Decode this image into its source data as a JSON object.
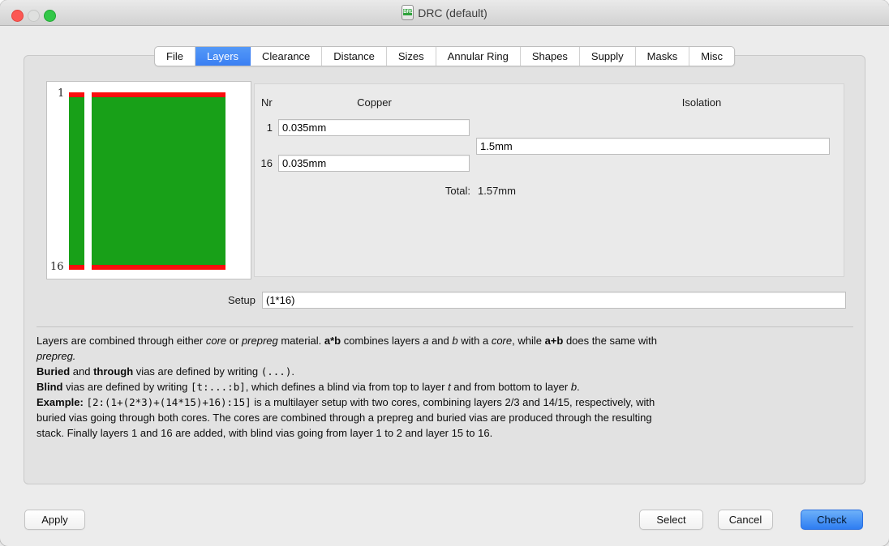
{
  "window": {
    "title": "DRC (default)",
    "icon_label": "BRD"
  },
  "tabs": [
    {
      "label": "File",
      "selected": false
    },
    {
      "label": "Layers",
      "selected": true
    },
    {
      "label": "Clearance",
      "selected": false
    },
    {
      "label": "Distance",
      "selected": false
    },
    {
      "label": "Sizes",
      "selected": false
    },
    {
      "label": "Annular Ring",
      "selected": false
    },
    {
      "label": "Shapes",
      "selected": false
    },
    {
      "label": "Supply",
      "selected": false
    },
    {
      "label": "Masks",
      "selected": false
    },
    {
      "label": "Misc",
      "selected": false
    }
  ],
  "preview": {
    "top_layer_label": "1",
    "bottom_layer_label": "16"
  },
  "stack_table": {
    "headers": {
      "nr": "Nr",
      "copper": "Copper",
      "isolation": "Isolation"
    },
    "rows": [
      {
        "nr": "1",
        "copper": "0.035mm"
      },
      {
        "nr": "16",
        "copper": "0.035mm"
      }
    ],
    "isolation_value": "1.5mm",
    "total_label": "Total:",
    "total_value": "1.57mm"
  },
  "setup": {
    "label": "Setup",
    "value": "(1*16)"
  },
  "description": {
    "lines": [
      [
        {
          "t": "Layers are combined through either "
        },
        {
          "t": "core",
          "s": "i"
        },
        {
          "t": " or "
        },
        {
          "t": "prepreg",
          "s": "i"
        },
        {
          "t": " material. "
        },
        {
          "t": "a*b",
          "s": "b"
        },
        {
          "t": " combines layers "
        },
        {
          "t": "a",
          "s": "i"
        },
        {
          "t": " and "
        },
        {
          "t": "b",
          "s": "i"
        },
        {
          "t": " with a "
        },
        {
          "t": "core",
          "s": "i"
        },
        {
          "t": ", while "
        },
        {
          "t": "a+b",
          "s": "b"
        },
        {
          "t": " does the same with"
        }
      ],
      [
        {
          "t": "prepreg.",
          "s": "i"
        }
      ],
      [
        {
          "t": "Buried",
          "s": "b"
        },
        {
          "t": " and "
        },
        {
          "t": "through",
          "s": "b"
        },
        {
          "t": " vias are defined by writing "
        },
        {
          "t": "(...)",
          "s": "m"
        },
        {
          "t": "."
        }
      ],
      [
        {
          "t": "Blind",
          "s": "b"
        },
        {
          "t": " vias are defined by writing "
        },
        {
          "t": "[t:...:b]",
          "s": "m"
        },
        {
          "t": ", which defines a blind via from top to layer "
        },
        {
          "t": "t",
          "s": "i"
        },
        {
          "t": " and from bottom to layer "
        },
        {
          "t": "b",
          "s": "i"
        },
        {
          "t": "."
        }
      ],
      [
        {
          "t": "Example:",
          "s": "b"
        },
        {
          "t": " "
        },
        {
          "t": "[2:(1+(2*3)+(14*15)+16):15]",
          "s": "m"
        },
        {
          "t": " is a multilayer setup with two cores, combining layers 2/3 and 14/15, respectively, with"
        }
      ],
      [
        {
          "t": "buried vias going through both cores. The cores are combined through a prepreg and buried vias are produced through the resulting"
        }
      ],
      [
        {
          "t": "stack. Finally layers 1 and 16 are added, with blind vias going from layer 1 to 2 and layer 15 to 16."
        }
      ]
    ]
  },
  "footer": {
    "apply": "Apply",
    "select": "Select",
    "cancel": "Cancel",
    "check": "Check"
  },
  "colors": {
    "selected_tab_blue": "#3f86f4",
    "check_button_blue": "#2e7df2",
    "copper_red": "#fb0d0d",
    "core_green": "#18a018"
  }
}
